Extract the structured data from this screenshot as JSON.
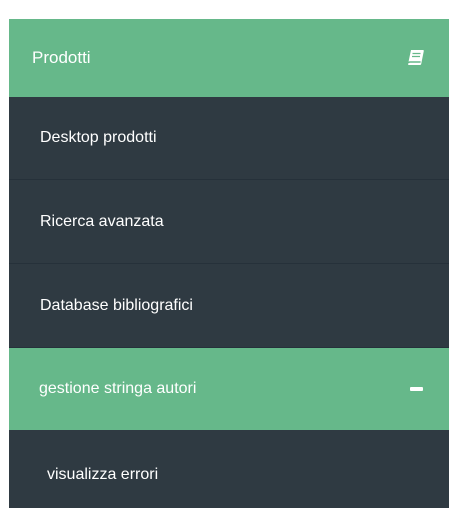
{
  "header": {
    "title": "Prodotti",
    "icon": "book-icon"
  },
  "items": [
    {
      "label": "Desktop prodotti"
    },
    {
      "label": "Ricerca avanzata"
    },
    {
      "label": "Database bibliografici"
    }
  ],
  "active_item": {
    "label": "gestione stringa autori",
    "icon": "minus-icon"
  },
  "sub_items": [
    {
      "label": "visualizza errori"
    }
  ],
  "colors": {
    "accent": "#66b88a",
    "menu_background": "#2f3a42",
    "text": "#ffffff"
  }
}
